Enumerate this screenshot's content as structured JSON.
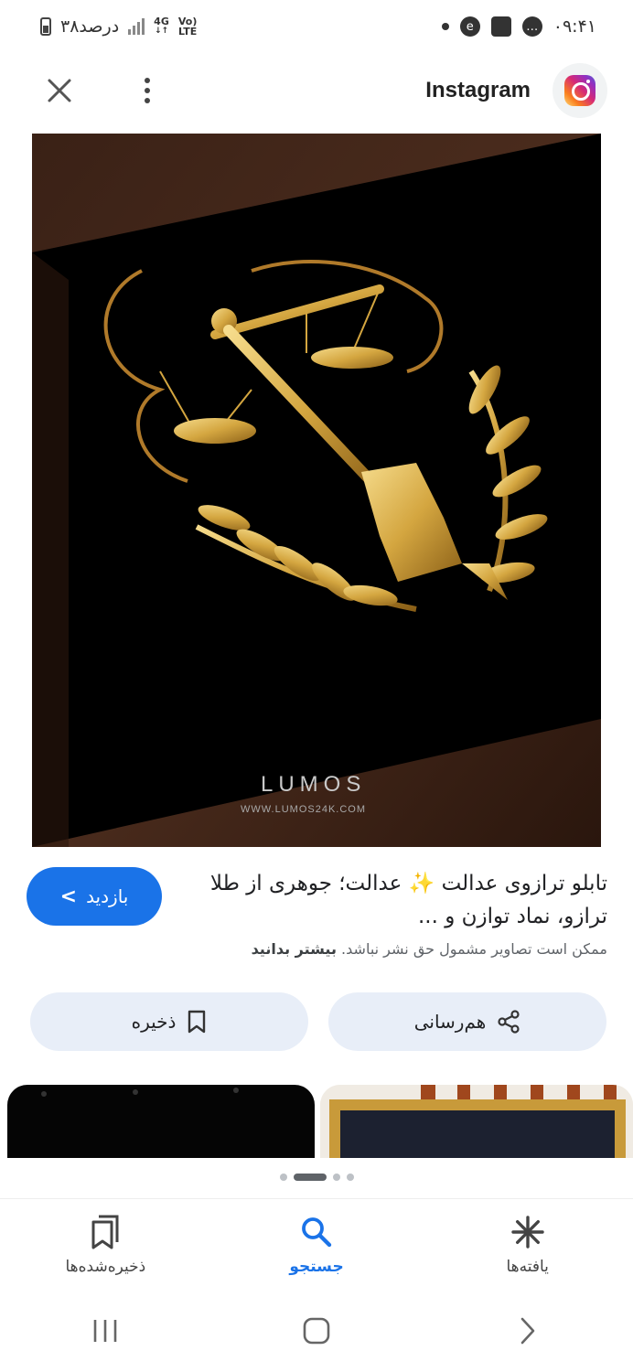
{
  "status_bar": {
    "battery_text": "۳۸درصد",
    "network": "4G",
    "network_sub": "LTE",
    "volte": "Vo)",
    "time": "۰۹:۴۱"
  },
  "header": {
    "site_name": "Instagram",
    "icons": [
      "close-icon",
      "more-vert-icon",
      "instagram-logo"
    ]
  },
  "main_image": {
    "brand": "LUMOS",
    "url": "WWW.LUMOS24K.COM"
  },
  "result": {
    "visit_label": "بازدید",
    "title": "تابلو ترازوی عدالت ✨ عدالت؛ جوهری از طلا ترازو، نماد توازن و ...",
    "copyright_text": "ممکن است تصاویر مشمول حق نشر نباشد.",
    "learn_more": "بیشتر بدانید"
  },
  "actions": {
    "share_label": "هم‌رسانی",
    "save_label": "ذخیره"
  },
  "pager": {
    "count": 4,
    "active_index": 1
  },
  "bottom_nav": {
    "items": [
      {
        "label": "یافته‌ها",
        "icon": "asterisk-icon"
      },
      {
        "label": "جستجو",
        "icon": "search-icon"
      },
      {
        "label": "ذخیره‌شده‌ها",
        "icon": "saved-icon"
      }
    ],
    "active": "جستجو"
  },
  "colors": {
    "accent": "#1a73e8",
    "action_bg": "#e8eef8",
    "gold": "#d4a640"
  }
}
